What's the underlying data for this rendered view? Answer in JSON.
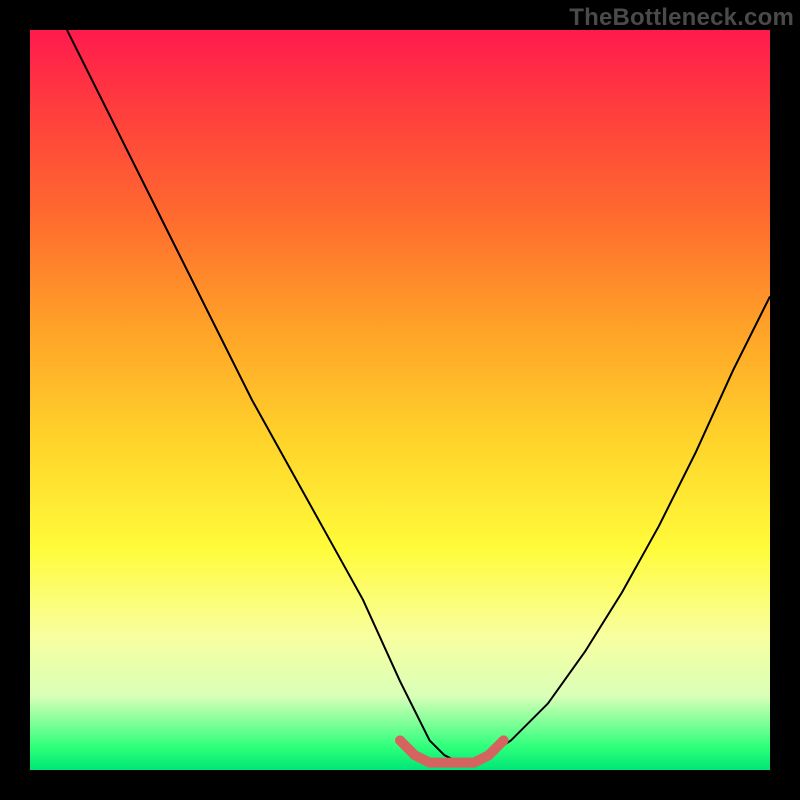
{
  "watermark": "TheBottleneck.com",
  "chart_data": {
    "type": "line",
    "title": "",
    "xlabel": "",
    "ylabel": "",
    "xlim": [
      0,
      100
    ],
    "ylim": [
      0,
      100
    ],
    "background_gradient": {
      "top": "#ff1a4d",
      "mid_upper": "#ffa128",
      "mid": "#fffb3a",
      "bottom": "#00e676"
    },
    "series": [
      {
        "name": "bottleneck-curve",
        "color": "#000000",
        "stroke_width": 2,
        "x": [
          5,
          10,
          15,
          20,
          25,
          30,
          35,
          40,
          45,
          50,
          52,
          54,
          56,
          58,
          60,
          62,
          65,
          70,
          75,
          80,
          85,
          90,
          95,
          100
        ],
        "y": [
          100,
          90,
          80,
          70,
          60,
          50,
          41,
          32,
          23,
          12,
          8,
          4,
          2,
          1,
          1,
          2,
          4,
          9,
          16,
          24,
          33,
          43,
          54,
          64
        ]
      },
      {
        "name": "optimal-band-marker",
        "color": "#d4645f",
        "stroke_width": 10,
        "x": [
          50,
          52,
          54,
          56,
          58,
          60,
          62,
          64
        ],
        "y": [
          4,
          2,
          1,
          1,
          1,
          1,
          2,
          4
        ]
      }
    ],
    "annotations": []
  }
}
